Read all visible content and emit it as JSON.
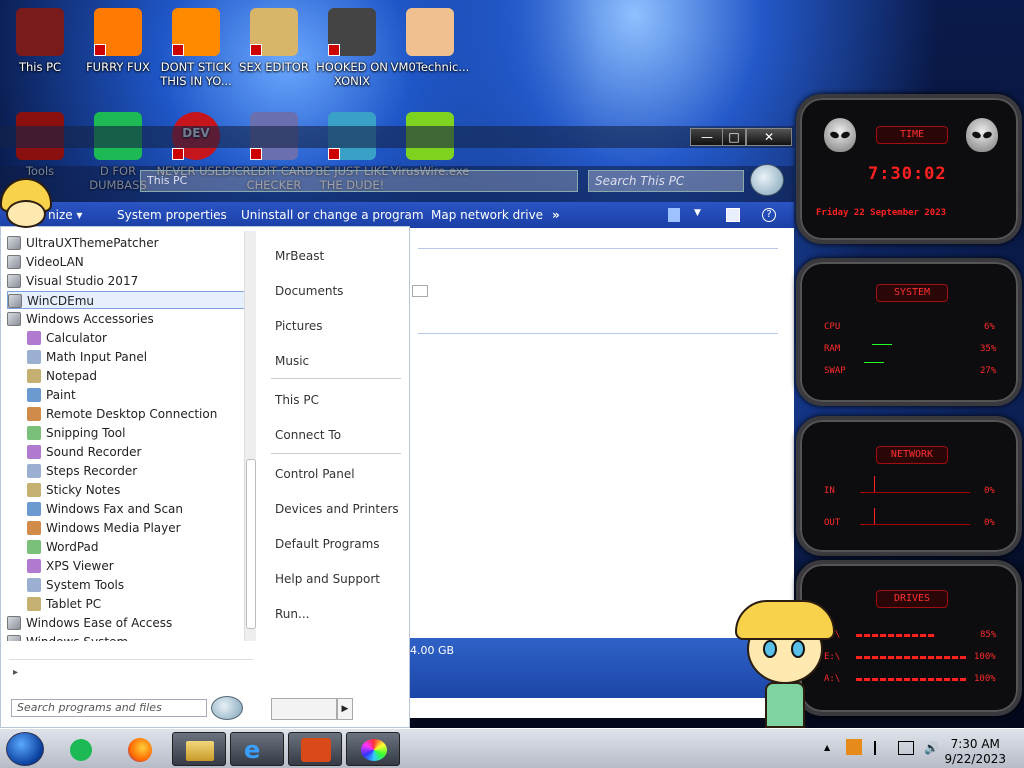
{
  "desktop_icons": [
    {
      "label": "This PC",
      "color": "#7a1b1b"
    },
    {
      "label": "FURRY FUX",
      "color": "#ff7a00"
    },
    {
      "label": "DONT STICK THIS IN YO...",
      "color": "#ff8a00"
    },
    {
      "label": "SEX EDITOR",
      "color": "#d9b56a"
    },
    {
      "label": "HOOKED ON XONIX",
      "color": "#444"
    },
    {
      "label": "VM0Technic...",
      "color": "#f0c090"
    },
    {
      "label": "Tools",
      "color": "#8a1010"
    },
    {
      "label": "D FOR DUMBASS",
      "color": "#1db954"
    },
    {
      "label": "NEVER USED!",
      "color": "#c4161c"
    },
    {
      "label": "CREDIT CARD CHECKER",
      "color": "#6a6fb0"
    },
    {
      "label": "BE JUST LIKE THE DUDE!",
      "color": "#3aa0c8"
    },
    {
      "label": "VirusWire.exe",
      "color": "#7ed321"
    }
  ],
  "dev_icon_text": "DEV",
  "explorer": {
    "address": "This PC",
    "search_placeholder": "Search This PC",
    "window_controls": {
      "minimize": "—",
      "maximize": "□",
      "close": "✕"
    },
    "toolbar": {
      "organize": "nize ▾",
      "system_properties": "System properties",
      "uninstall": "Uninstall or change a program",
      "map_drive": "Map network drive",
      "more": "»"
    },
    "status_size": "4.00 GB"
  },
  "start_menu": {
    "programs": [
      {
        "label": "UltraUXThemePatcher",
        "indent": 0,
        "selected": false
      },
      {
        "label": "VideoLAN",
        "indent": 0,
        "selected": false
      },
      {
        "label": "Visual Studio 2017",
        "indent": 0,
        "selected": false
      },
      {
        "label": "WinCDEmu",
        "indent": 0,
        "selected": true
      },
      {
        "label": "Windows Accessories",
        "indent": 0,
        "selected": false
      },
      {
        "label": "Calculator",
        "indent": 1,
        "selected": false
      },
      {
        "label": "Math Input Panel",
        "indent": 1,
        "selected": false
      },
      {
        "label": "Notepad",
        "indent": 1,
        "selected": false
      },
      {
        "label": "Paint",
        "indent": 1,
        "selected": false
      },
      {
        "label": "Remote Desktop Connection",
        "indent": 1,
        "selected": false
      },
      {
        "label": "Snipping Tool",
        "indent": 1,
        "selected": false
      },
      {
        "label": "Sound Recorder",
        "indent": 1,
        "selected": false
      },
      {
        "label": "Steps Recorder",
        "indent": 1,
        "selected": false
      },
      {
        "label": "Sticky Notes",
        "indent": 1,
        "selected": false
      },
      {
        "label": "Windows Fax and Scan",
        "indent": 1,
        "selected": false
      },
      {
        "label": "Windows Media Player",
        "indent": 1,
        "selected": false
      },
      {
        "label": "WordPad",
        "indent": 1,
        "selected": false
      },
      {
        "label": "XPS Viewer",
        "indent": 1,
        "selected": false
      },
      {
        "label": "System Tools",
        "indent": 1,
        "selected": false
      },
      {
        "label": "Tablet PC",
        "indent": 1,
        "selected": false
      },
      {
        "label": "Windows Ease of Access",
        "indent": 0,
        "selected": false
      },
      {
        "label": "Windows System",
        "indent": 0,
        "selected": false
      }
    ],
    "back_label": "▸",
    "search_placeholder": "Search programs and files",
    "right_items": [
      "MrBeast",
      "Documents",
      "Pictures",
      "Music",
      "This PC",
      "Connect To",
      "Control Panel",
      "Devices and Printers",
      "Default Programs",
      "Help and Support",
      "Run..."
    ],
    "shutdown_arrow": "▶"
  },
  "gadgets": {
    "time": {
      "title": "TIME",
      "clock": "7:30:02",
      "date": "Friday 22 September 2023"
    },
    "system": {
      "title": "SYSTEM",
      "rows": [
        {
          "label": "CPU",
          "value": "6%"
        },
        {
          "label": "RAM",
          "value": "35%"
        },
        {
          "label": "SWAP",
          "value": "27%"
        }
      ]
    },
    "network": {
      "title": "NETWORK",
      "rows": [
        {
          "label": "IN",
          "value": "0%"
        },
        {
          "label": "OUT",
          "value": "0%"
        }
      ]
    },
    "drives": {
      "title": "DRIVES",
      "rows": [
        {
          "label": "C:\\",
          "value": "85%"
        },
        {
          "label": "E:\\",
          "value": "100%"
        },
        {
          "label": "A:\\",
          "value": "100%"
        }
      ]
    }
  },
  "taskbar": {
    "time": "7:30 AM",
    "date": "9/22/2023",
    "tray_up": "▲"
  }
}
